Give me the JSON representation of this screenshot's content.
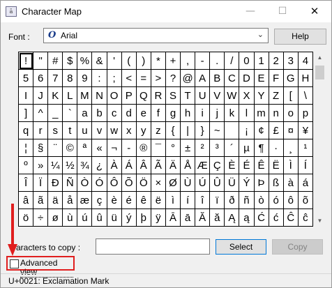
{
  "window": {
    "title": "Character Map",
    "icon": "character-map-app-icon",
    "minimize": "—",
    "maximize": "☐",
    "close": "✕"
  },
  "font": {
    "label": "Font :",
    "selected": "Arial",
    "icon": "opentype-font-icon",
    "glyph": "O"
  },
  "buttons": {
    "help": "Help",
    "select": "Select",
    "copy": "Copy"
  },
  "grid": {
    "selected_index": 0,
    "rows": [
      [
        "!",
        "\"",
        "#",
        "$",
        "%",
        "&",
        "'",
        "(",
        ")",
        "*",
        "+",
        ",",
        "-",
        ".",
        "/",
        "0",
        "1",
        "2",
        "3",
        "4"
      ],
      [
        "5",
        "6",
        "7",
        "8",
        "9",
        ":",
        ";",
        "<",
        "=",
        ">",
        "?",
        "@",
        "A",
        "B",
        "C",
        "D",
        "E",
        "F",
        "G",
        "H"
      ],
      [
        "I",
        "J",
        "K",
        "L",
        "M",
        "N",
        "O",
        "P",
        "Q",
        "R",
        "S",
        "T",
        "U",
        "V",
        "W",
        "X",
        "Y",
        "Z",
        "[",
        "\\"
      ],
      [
        "]",
        "^",
        "_",
        "`",
        "a",
        "b",
        "c",
        "d",
        "e",
        "f",
        "g",
        "h",
        "i",
        "j",
        "k",
        "l",
        "m",
        "n",
        "o",
        "p"
      ],
      [
        "q",
        "r",
        "s",
        "t",
        "u",
        "v",
        "w",
        "x",
        "y",
        "z",
        "{",
        "|",
        "}",
        "~",
        " ",
        "¡",
        "¢",
        "£",
        "¤",
        "¥"
      ],
      [
        "¦",
        "§",
        "¨",
        "©",
        "ª",
        "«",
        "¬",
        "-",
        "®",
        "¯",
        "°",
        "±",
        "²",
        "³",
        "´",
        "µ",
        "¶",
        "·",
        "¸",
        "¹"
      ],
      [
        "º",
        "»",
        "¼",
        "½",
        "¾",
        "¿",
        "À",
        "Á",
        "Â",
        "Ã",
        "Ä",
        "Å",
        "Æ",
        "Ç",
        "È",
        "É",
        "Ê",
        "Ë",
        "Ì",
        "Í"
      ],
      [
        "Î",
        "Ï",
        "Ð",
        "Ñ",
        "Ò",
        "Ó",
        "Ô",
        "Õ",
        "Ö",
        "×",
        "Ø",
        "Ù",
        "Ú",
        "Û",
        "Ü",
        "Ý",
        "Þ",
        "ß",
        "à",
        "á"
      ],
      [
        "â",
        "ã",
        "ä",
        "å",
        "æ",
        "ç",
        "è",
        "é",
        "ê",
        "ë",
        "ì",
        "í",
        "î",
        "ï",
        "ð",
        "ñ",
        "ò",
        "ó",
        "ô",
        "õ"
      ],
      [
        "ö",
        "÷",
        "ø",
        "ù",
        "ú",
        "û",
        "ü",
        "ý",
        "þ",
        "ÿ",
        "Ā",
        "ā",
        "Ă",
        "ă",
        "Ą",
        "ą",
        "Ć",
        "ć",
        "Ĉ",
        "ĉ"
      ]
    ]
  },
  "scrollbar": {
    "up": "▲",
    "down": "▼"
  },
  "copy": {
    "label": "Characters to copy :",
    "visible_label": "aracters to copy :",
    "value": ""
  },
  "advanced": {
    "label": "Advanced view",
    "checked": false
  },
  "status": {
    "text": "U+0021: Exclamation Mark"
  },
  "colors": {
    "highlight": "#e01e1e",
    "button_focus_border": "#0078d7",
    "window_bg": "#f0f0f0"
  }
}
